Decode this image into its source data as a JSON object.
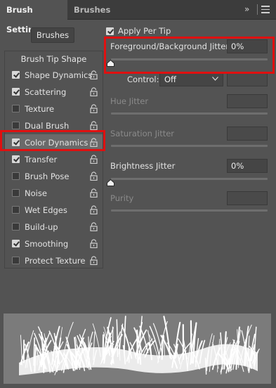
{
  "tabs": [
    {
      "label": "Brush Settings",
      "active": true
    },
    {
      "label": "Brushes",
      "active": false
    }
  ],
  "header_icons": {
    "collapse": "»",
    "menu": "menu-icon"
  },
  "brushes_button": "Brushes",
  "list": {
    "header": "Brush Tip Shape",
    "items": [
      {
        "label": "Shape Dynamics",
        "checked": true
      },
      {
        "label": "Scattering",
        "checked": true
      },
      {
        "label": "Texture",
        "checked": false
      },
      {
        "label": "Dual Brush",
        "checked": false
      },
      {
        "label": "Color Dynamics",
        "checked": true,
        "selected": true
      },
      {
        "label": "Transfer",
        "checked": true
      },
      {
        "label": "Brush Pose",
        "checked": false
      },
      {
        "label": "Noise",
        "checked": false
      },
      {
        "label": "Wet Edges",
        "checked": false
      },
      {
        "label": "Build-up",
        "checked": false
      },
      {
        "label": "Smoothing",
        "checked": true
      },
      {
        "label": "Protect Texture",
        "checked": false
      }
    ]
  },
  "apply_per_tip": {
    "label": "Apply Per Tip",
    "checked": true
  },
  "params": {
    "fg_bg_jitter": {
      "label": "Foreground/Background Jitter",
      "value": "0%",
      "slider_fraction": 0
    },
    "control": {
      "label": "Control:",
      "value": "Off"
    },
    "hue_jitter": {
      "label": "Hue Jitter",
      "value": ""
    },
    "saturation_jitter": {
      "label": "Saturation Jitter",
      "value": ""
    },
    "brightness_jitter": {
      "label": "Brightness Jitter",
      "value": "0%",
      "slider_fraction": 0
    },
    "purity": {
      "label": "Purity",
      "value": ""
    }
  },
  "colors": {
    "panel_bg": "#535353",
    "tabbar_bg": "#3c3c3c",
    "highlight": "#e01010",
    "preview_bg": "#7b7b7b"
  }
}
